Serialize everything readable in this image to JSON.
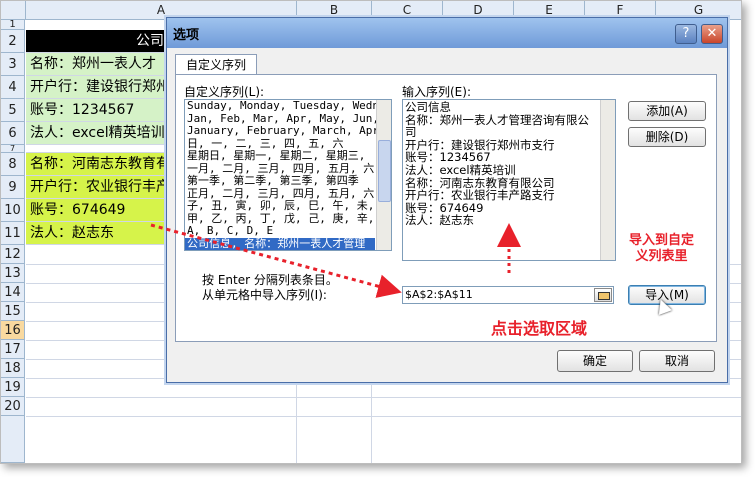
{
  "sheet": {
    "columns": [
      "A",
      "B",
      "C",
      "D",
      "E",
      "F",
      "G"
    ],
    "rows": [
      "1",
      "2",
      "3",
      "4",
      "5",
      "6",
      "7",
      "8",
      "9",
      "10",
      "11",
      "12",
      "13",
      "14",
      "15",
      "16",
      "17",
      "18",
      "19",
      "20"
    ],
    "active_row": "16",
    "cells": {
      "a2": "公司",
      "a3": "名称：郑州一表人才",
      "a4": "开户行：建设银行郑州",
      "a5": "账号：1234567",
      "a6": "法人：excel精英培训",
      "a8": "名称：河南志东教育有",
      "a9": "开户行：农业银行丰产",
      "a10": "账号：674649",
      "a11": "法人：赵志东"
    },
    "colors": {
      "header_black": "#000000",
      "green": "#d5f2c7",
      "yellow": "#d6f34a"
    }
  },
  "dialog": {
    "title": "选项",
    "help_glyph": "?",
    "close_glyph": "✕",
    "tab": "自定义序列",
    "custom_list_label": "自定义序列(L):",
    "custom_list_items": [
      "Sunday, Monday, Tuesday, Wednes",
      "Jan, Feb, Mar, Apr, May, Jun, J",
      "January, February, March, April,",
      "日, 一, 二, 三, 四, 五, 六",
      "星期日, 星期一, 星期二, 星期三,",
      "一月, 二月, 三月, 四月, 五月, 六",
      "第一季, 第二季, 第三季, 第四季",
      "正月, 二月, 三月, 四月, 五月, 六",
      "子, 丑, 寅, 卯, 辰, 巳, 午, 未,",
      "甲, 乙, 丙, 丁, 戊, 己, 庚, 辛,",
      "A, B, C, D, E",
      "公司信息, 名称：郑州一表人才管理"
    ],
    "input_list_label": "输入序列(E):",
    "input_list_items": [
      "公司信息",
      "名称：郑州一表人才管理咨询有限公",
      "司",
      "开户行：建设银行郑州市支行",
      "账号：1234567",
      "法人：excel精英培训",
      "名称：河南志东教育有限公司",
      "开户行：农业银行丰产路支行",
      "账号：674649",
      "法人：赵志东"
    ],
    "add_button": "添加(A)",
    "delete_button": "删除(D)",
    "hint": "按 Enter 分隔列表条目。",
    "import_label": "从单元格中导入序列(I):",
    "import_range": "$A$2:$A$11",
    "import_button": "导入(M)",
    "ok_button": "确定",
    "cancel_button": "取消"
  },
  "annotations": {
    "import_note_line1": "导入到自定",
    "import_note_line2": "义列表里",
    "select_note": "点击选取区域",
    "color": "#e8212b"
  }
}
